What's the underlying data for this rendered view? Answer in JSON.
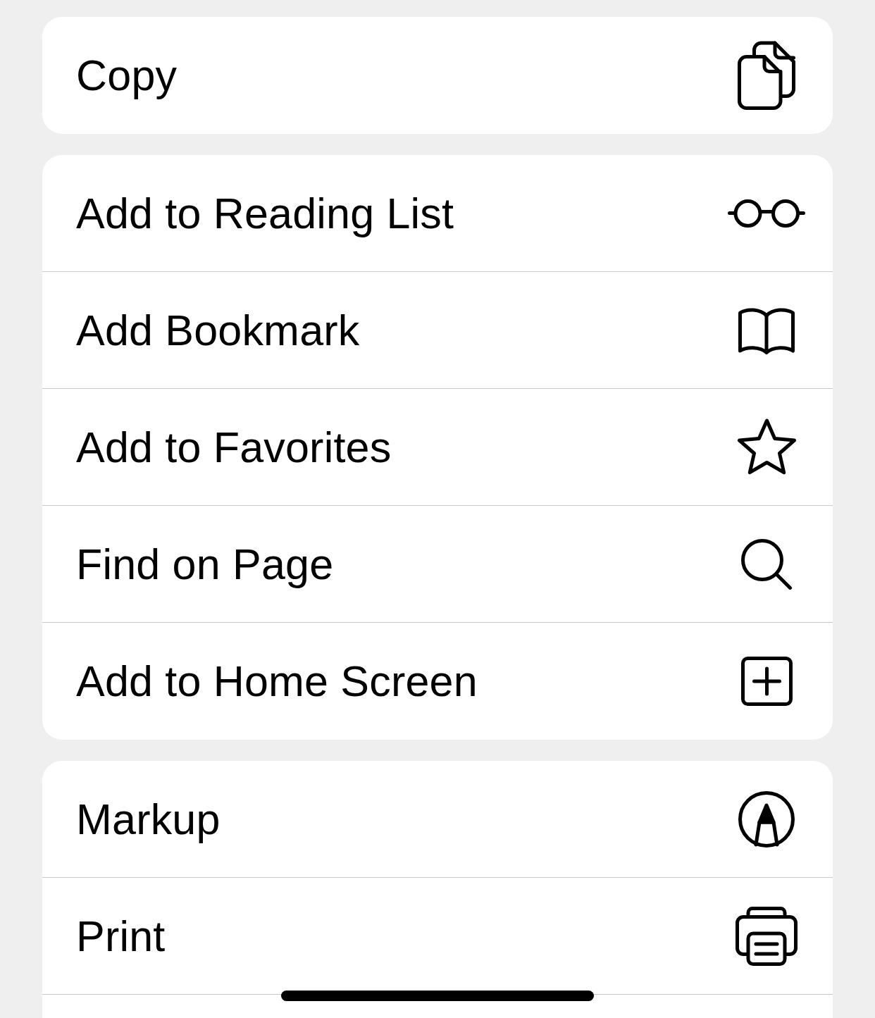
{
  "groups": [
    {
      "items": [
        {
          "label": "Copy",
          "kind": "copy"
        }
      ]
    },
    {
      "items": [
        {
          "label": "Add to Reading List",
          "kind": "reading-list"
        },
        {
          "label": "Add Bookmark",
          "kind": "bookmark"
        },
        {
          "label": "Add to Favorites",
          "kind": "favorite"
        },
        {
          "label": "Find on Page",
          "kind": "find"
        },
        {
          "label": "Add to Home Screen",
          "kind": "home-screen"
        }
      ]
    },
    {
      "items": [
        {
          "label": "Markup",
          "kind": "markup"
        },
        {
          "label": "Print",
          "kind": "print"
        }
      ]
    }
  ]
}
